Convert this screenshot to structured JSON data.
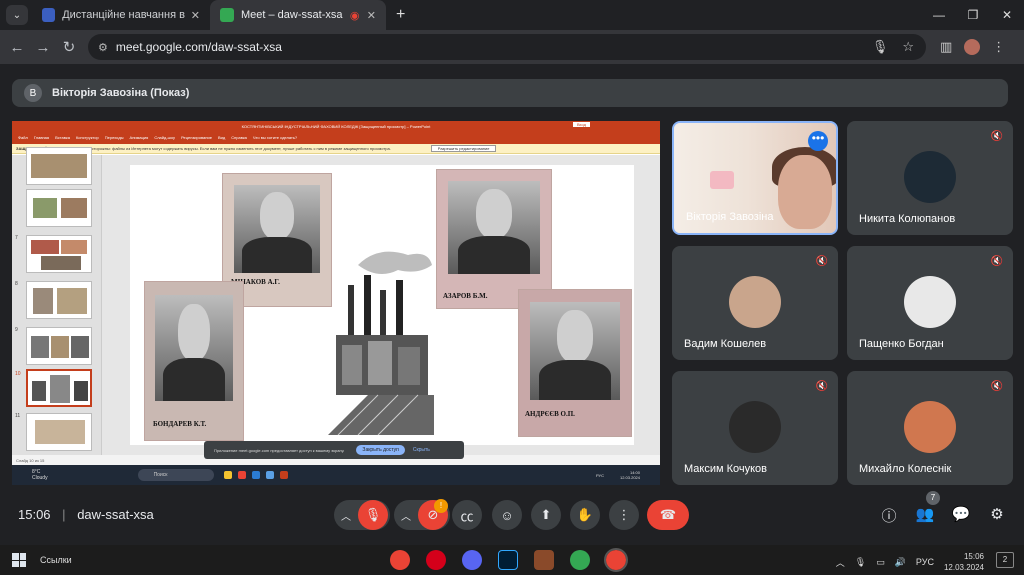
{
  "browser": {
    "tabs": [
      {
        "title": "Дистанційне навчання в ВСП",
        "color": "#3b5fc0"
      },
      {
        "title": "Meet – daw-ssat-xsa",
        "color": "#34a853"
      }
    ],
    "url": "meet.google.com/daw-ssat-xsa"
  },
  "presenter": {
    "initial": "В",
    "label": "Вікторія Завозіна (Показ)"
  },
  "shared_screen": {
    "window_title": "КОСТЯНТИНІВСЬКИЙ ІНДУСТРІАЛЬНИЙ ФАХОВИЙ КОЛЕДЖ [Защищенный просмотр] – PowerPoint",
    "login": "Вход",
    "ribbon": [
      "Файл",
      "Главная",
      "Вставка",
      "Конструктор",
      "Переходы",
      "Анимация",
      "Слайд-шоу",
      "Рецензирование",
      "Вид",
      "Справка",
      "Что вы хотите сделать?"
    ],
    "protected_label": "ЗАЩИЩЕННЫЙ ПРОСМОТР",
    "protected_text": "Будьте осторожны: файлы из Интернета могут содержать вирусы. Если вам не нужно изменять этот документ, лучше работать с ним в режиме защищенного просмотра.",
    "enable_editing": "Разрешить редактирование",
    "slide_numbers": [
      "7",
      "8",
      "9",
      "10",
      "11"
    ],
    "portraits": [
      {
        "name": "МІНАКОВ А.Г."
      },
      {
        "name": "АЗАРОВ Б.М."
      },
      {
        "name": "БОНДАРЕВ К.Т."
      },
      {
        "name": "АНДРЄЄВ О.П."
      }
    ],
    "status_text": "Слайд 10 из 15",
    "notice_text": "Приложение meet.google.com предоставляет доступ к вашему экрану.",
    "notice_open": "Закрыть доступ",
    "notice_hide": "Скрыть",
    "weather_temp": "8°C",
    "weather_text": "Cloudy",
    "search": "Поиск",
    "lang": "РУС",
    "time": "14:00",
    "date": "12.03.2024"
  },
  "participants": [
    {
      "name": "Вікторія Завозіна",
      "avatar_color": "#d8aa94",
      "active": true
    },
    {
      "name": "Никита Колюпанов",
      "avatar_color": "#1d2a35",
      "active": false
    },
    {
      "name": "Вадим Кошелев",
      "avatar_color": "#c9a58c",
      "active": false
    },
    {
      "name": "Пащенко Богдан",
      "avatar_color": "#e8e8e8",
      "active": false
    },
    {
      "name": "Максим Кочуков",
      "avatar_color": "#2a2a2a",
      "active": false
    },
    {
      "name": "Михайло Колеснік",
      "avatar_color": "#d0774f",
      "active": false
    }
  ],
  "meeting": {
    "time": "15:06",
    "separator": "|",
    "code": "daw-ssat-xsa",
    "camera_badge": "!",
    "people_count": "7"
  },
  "windows": {
    "links": "Ссылки",
    "lang": "РУС",
    "time": "15:06",
    "date": "12.03.2024",
    "notifications": "2"
  }
}
